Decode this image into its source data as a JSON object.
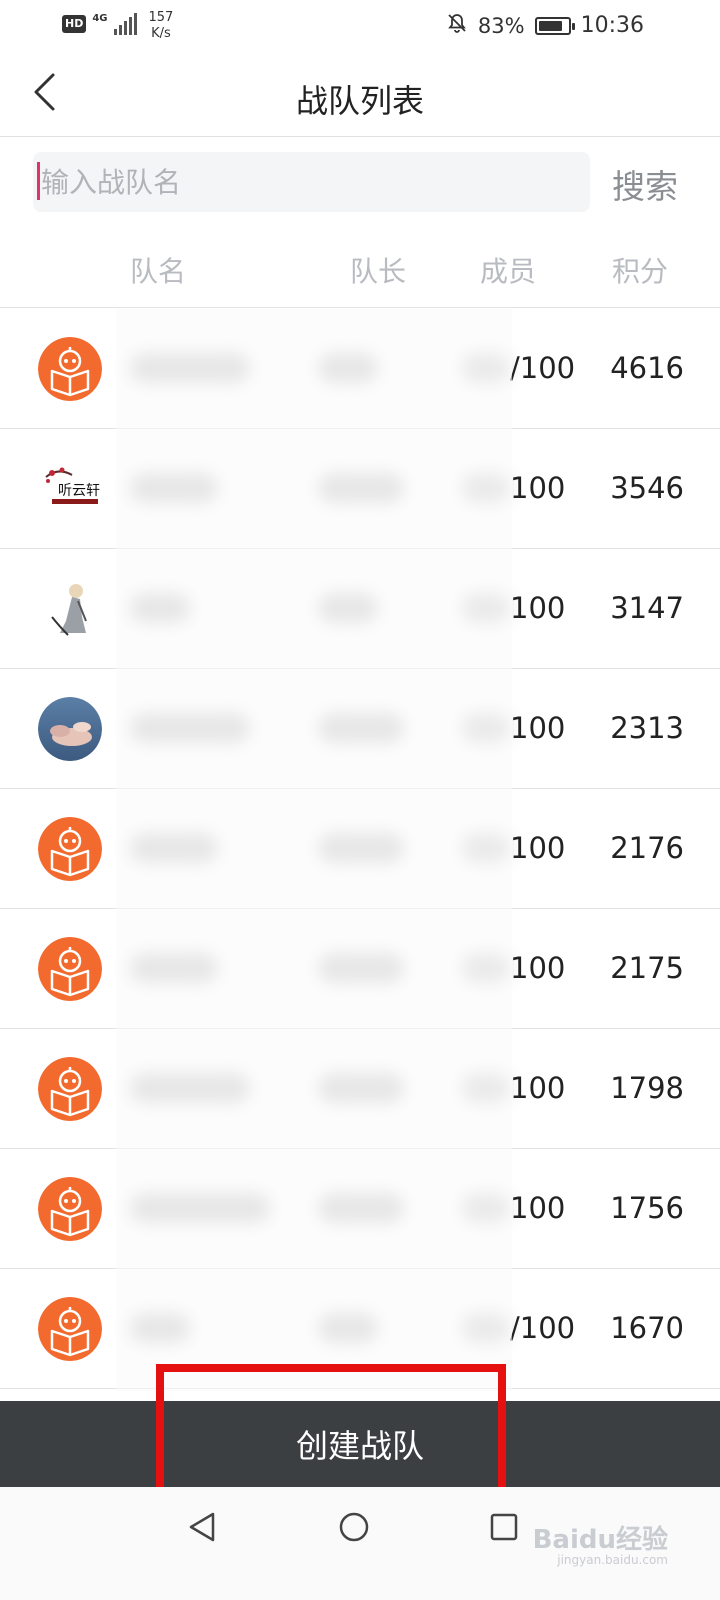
{
  "status_bar": {
    "hd": "HD",
    "network": "4G",
    "speed_value": "157",
    "speed_unit": "K/s",
    "battery_text": "83%",
    "battery_level": 0.83,
    "time": "10:36"
  },
  "header": {
    "title": "战队列表",
    "back_icon": "chevron-left-icon"
  },
  "search": {
    "placeholder": "输入战队名",
    "value": "",
    "button_label": "搜索"
  },
  "columns": {
    "name": "队名",
    "leader": "队长",
    "members": "成员",
    "score": "积分"
  },
  "teams": [
    {
      "avatar": "orange-reading-robot",
      "members": "/100",
      "score": "4616"
    },
    {
      "avatar": "plum-blossom-calligraphy",
      "members": "100",
      "score": "3546"
    },
    {
      "avatar": "anime-figure",
      "members": "100",
      "score": "3147"
    },
    {
      "avatar": "sky-clouds",
      "members": "100",
      "score": "2313"
    },
    {
      "avatar": "orange-reading-robot",
      "members": "100",
      "score": "2176"
    },
    {
      "avatar": "orange-reading-robot",
      "members": "100",
      "score": "2175"
    },
    {
      "avatar": "orange-reading-robot",
      "members": "100",
      "score": "1798"
    },
    {
      "avatar": "orange-reading-robot",
      "members": "100",
      "score": "1756"
    },
    {
      "avatar": "orange-reading-robot",
      "members": "/100",
      "score": "1670"
    }
  ],
  "create_button": {
    "label": "创建战队",
    "highlight_color": "#e51111"
  },
  "nav_bar": {
    "back": "triangle-back-icon",
    "home": "circle-home-icon",
    "recent": "square-recent-icon"
  },
  "watermark": {
    "text": "Baidu经验",
    "sub": "jingyan.baidu.com"
  },
  "colors": {
    "accent_caret": "#e0336a",
    "avatar_orange": "#f26a2e",
    "create_bar": "#3c3f42"
  }
}
